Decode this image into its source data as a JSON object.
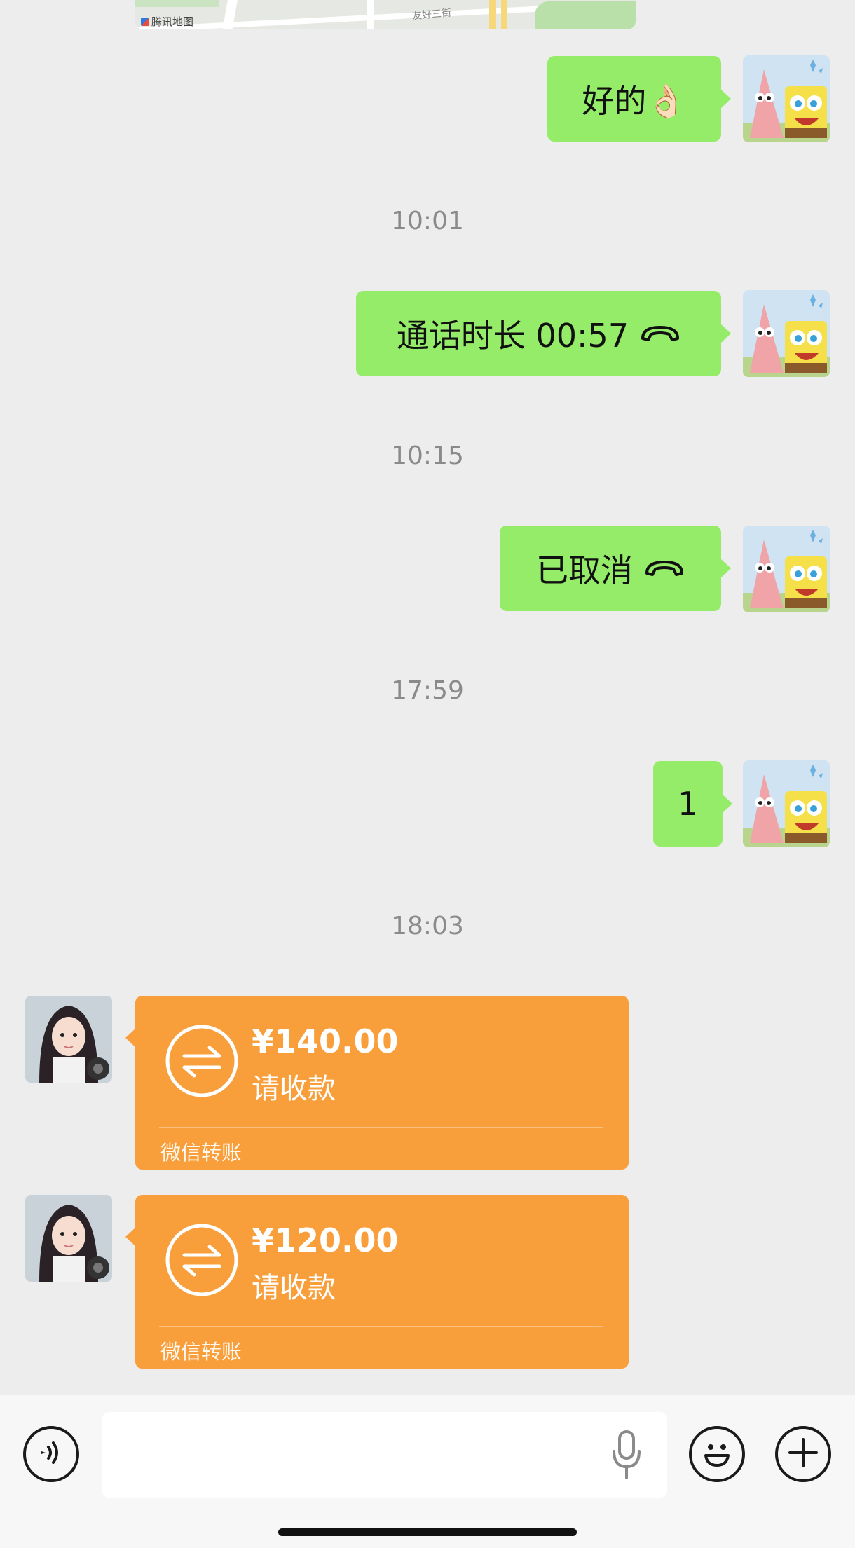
{
  "map": {
    "provider_label": "腾讯地图",
    "street_label": "友好三街"
  },
  "messages": {
    "m1": {
      "text": "好的",
      "emoji": "👌🏻"
    },
    "t1": "10:01",
    "m2": {
      "text": "通话时长 00:57"
    },
    "t2": "10:15",
    "m3": {
      "text": "已取消"
    },
    "t3": "17:59",
    "m4": {
      "text": "1"
    },
    "t4": "18:03"
  },
  "transfers": [
    {
      "amount": "¥140.00",
      "status": "请收款",
      "brand": "微信转账"
    },
    {
      "amount": "¥120.00",
      "status": "请收款",
      "brand": "微信转账"
    }
  ],
  "input": {
    "value": "",
    "placeholder": ""
  },
  "colors": {
    "background": "#ededed",
    "outgoing_bubble": "#95ec69",
    "transfer_card": "#f89f3c",
    "timestamp": "#8a8a8a"
  },
  "icons": {
    "voice_toggle": "voice-icon",
    "mic": "microphone-icon",
    "emoji": "emoji-icon",
    "more": "plus-icon",
    "call": "phone-hangup-icon",
    "transfer": "transfer-arrows-icon"
  }
}
